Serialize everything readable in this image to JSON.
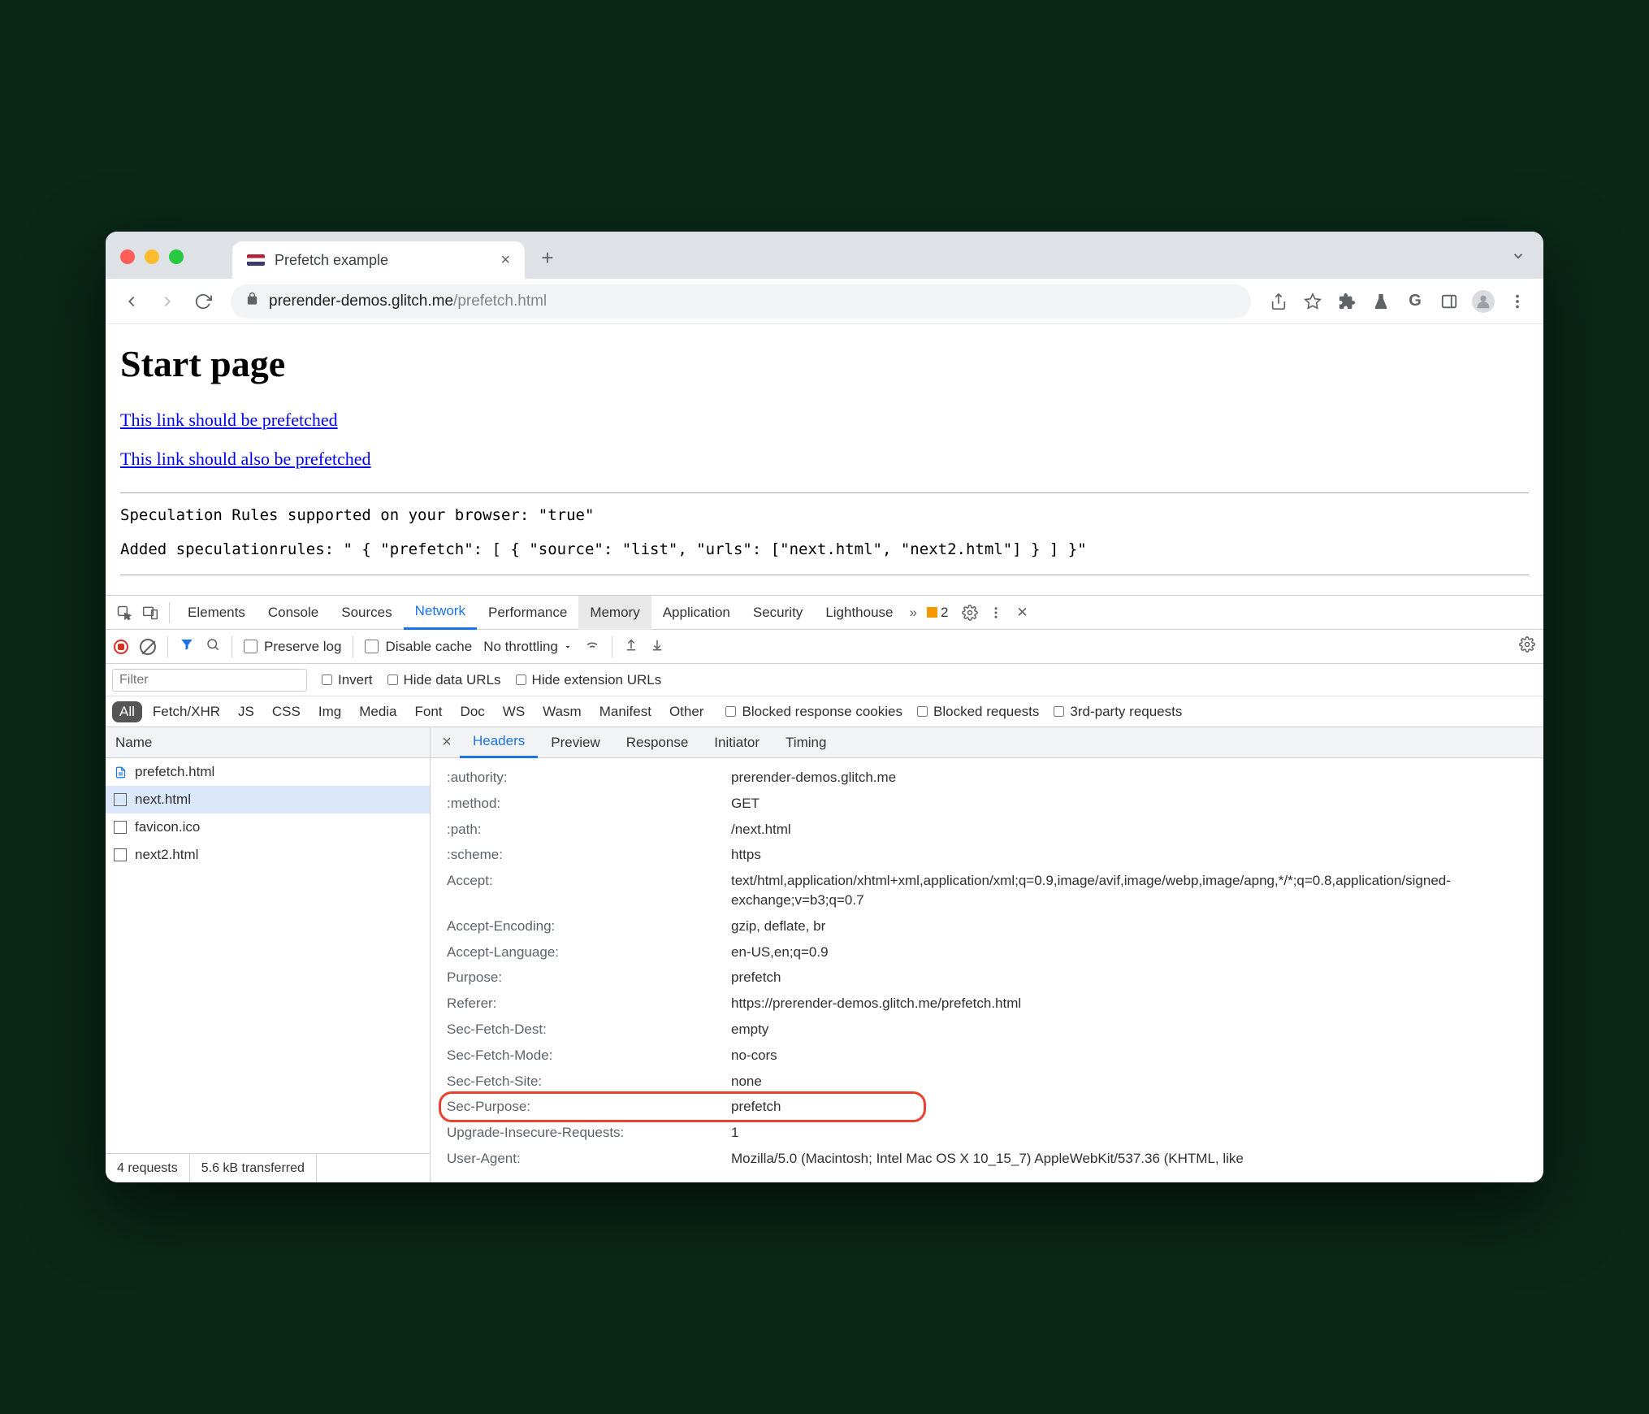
{
  "tab": {
    "title": "Prefetch example"
  },
  "url": {
    "host": "prerender-demos.glitch.me",
    "path": "/prefetch.html"
  },
  "page": {
    "heading": "Start page",
    "link1": "This link should be prefetched",
    "link2": "This link should also be prefetched",
    "line1": "Speculation Rules supported on your browser: \"true\"",
    "line2": "Added speculationrules: \" { \"prefetch\": [ { \"source\": \"list\", \"urls\": [\"next.html\", \"next2.html\"] } ] }\""
  },
  "devtools": {
    "panels": [
      "Elements",
      "Console",
      "Sources",
      "Network",
      "Performance",
      "Memory",
      "Application",
      "Security",
      "Lighthouse"
    ],
    "selected_panel": "Network",
    "hovered_panel": "Memory",
    "warn_count": "2",
    "net_toolbar": {
      "preserve": "Preserve log",
      "disable_cache": "Disable cache",
      "throttling": "No throttling"
    },
    "filter_placeholder": "Filter",
    "filter_opts": {
      "invert": "Invert",
      "hide_data": "Hide data URLs",
      "hide_ext": "Hide extension URLs"
    },
    "types": [
      "All",
      "Fetch/XHR",
      "JS",
      "CSS",
      "Img",
      "Media",
      "Font",
      "Doc",
      "WS",
      "Wasm",
      "Manifest",
      "Other"
    ],
    "type_opts": {
      "blocked_cookies": "Blocked response cookies",
      "blocked": "Blocked requests",
      "thirdparty": "3rd-party requests"
    },
    "name_header": "Name",
    "requests": [
      {
        "name": "prefetch.html",
        "icon": "doc"
      },
      {
        "name": "next.html",
        "icon": "box",
        "selected": true
      },
      {
        "name": "favicon.ico",
        "icon": "box"
      },
      {
        "name": "next2.html",
        "icon": "box"
      }
    ],
    "status": {
      "count": "4 requests",
      "transferred": "5.6 kB transferred"
    },
    "detail_tabs": [
      "Headers",
      "Preview",
      "Response",
      "Initiator",
      "Timing"
    ],
    "detail_selected": "Headers",
    "headers": [
      {
        "k": ":authority:",
        "v": "prerender-demos.glitch.me"
      },
      {
        "k": ":method:",
        "v": "GET"
      },
      {
        "k": ":path:",
        "v": "/next.html"
      },
      {
        "k": ":scheme:",
        "v": "https"
      },
      {
        "k": "Accept:",
        "v": "text/html,application/xhtml+xml,application/xml;q=0.9,image/avif,image/webp,image/apng,*/*;q=0.8,application/signed-exchange;v=b3;q=0.7"
      },
      {
        "k": "Accept-Encoding:",
        "v": "gzip, deflate, br"
      },
      {
        "k": "Accept-Language:",
        "v": "en-US,en;q=0.9"
      },
      {
        "k": "Purpose:",
        "v": "prefetch"
      },
      {
        "k": "Referer:",
        "v": "https://prerender-demos.glitch.me/prefetch.html"
      },
      {
        "k": "Sec-Fetch-Dest:",
        "v": "empty"
      },
      {
        "k": "Sec-Fetch-Mode:",
        "v": "no-cors"
      },
      {
        "k": "Sec-Fetch-Site:",
        "v": "none"
      },
      {
        "k": "Sec-Purpose:",
        "v": "prefetch",
        "hl": true
      },
      {
        "k": "Upgrade-Insecure-Requests:",
        "v": "1"
      },
      {
        "k": "User-Agent:",
        "v": "Mozilla/5.0 (Macintosh; Intel Mac OS X 10_15_7) AppleWebKit/537.36 (KHTML, like"
      }
    ]
  }
}
